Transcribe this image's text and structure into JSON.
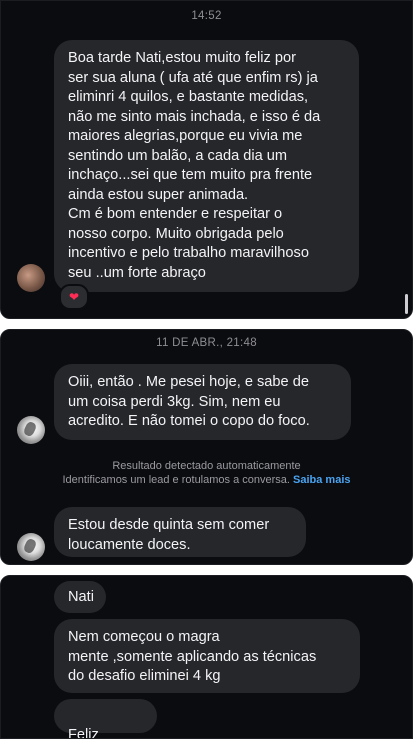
{
  "panel1": {
    "timestamp": "14:52",
    "message": "Boa tarde Nati,estou muito feliz por\nser sua aluna ( ufa até que enfim rs) ja\neliminri 4 quilos, e bastante medidas,\nnão me sinto mais inchada, e isso é da\nmaiores alegrias,porque eu vivia me\nsentindo um balão, a cada dia um\ninchaço...sei que tem muito pra frente\nainda estou super animada.\nCm é bom entender e respeitar o\nnosso corpo. Muito obrigada pelo\nincentivo e pelo trabalho maravilhoso\nseu ..um forte abraço",
    "reaction": "❤"
  },
  "panel2": {
    "timestamp": "11 DE ABR., 21:48",
    "message1": "Oiii, então .  Me pesei hoje, e sabe de\num coisa perdi 3kg. Sim, nem eu\nacredito. E não tomei o copo do foco.",
    "system_line1": "Resultado detectado automaticamente",
    "system_line2": "Identificamos um lead e rotulamos a conversa.",
    "system_link": "Saiba mais",
    "message2": "Estou desde quinta sem comer\nloucamente doces."
  },
  "panel3": {
    "message1": "Nati",
    "message2": "Nem começou o magra\nmente ,somente aplicando as técnicas\ndo desafio eliminei 4 kg",
    "message3_text": "Feliz",
    "message3_emojis": "🥺 ☺️"
  }
}
